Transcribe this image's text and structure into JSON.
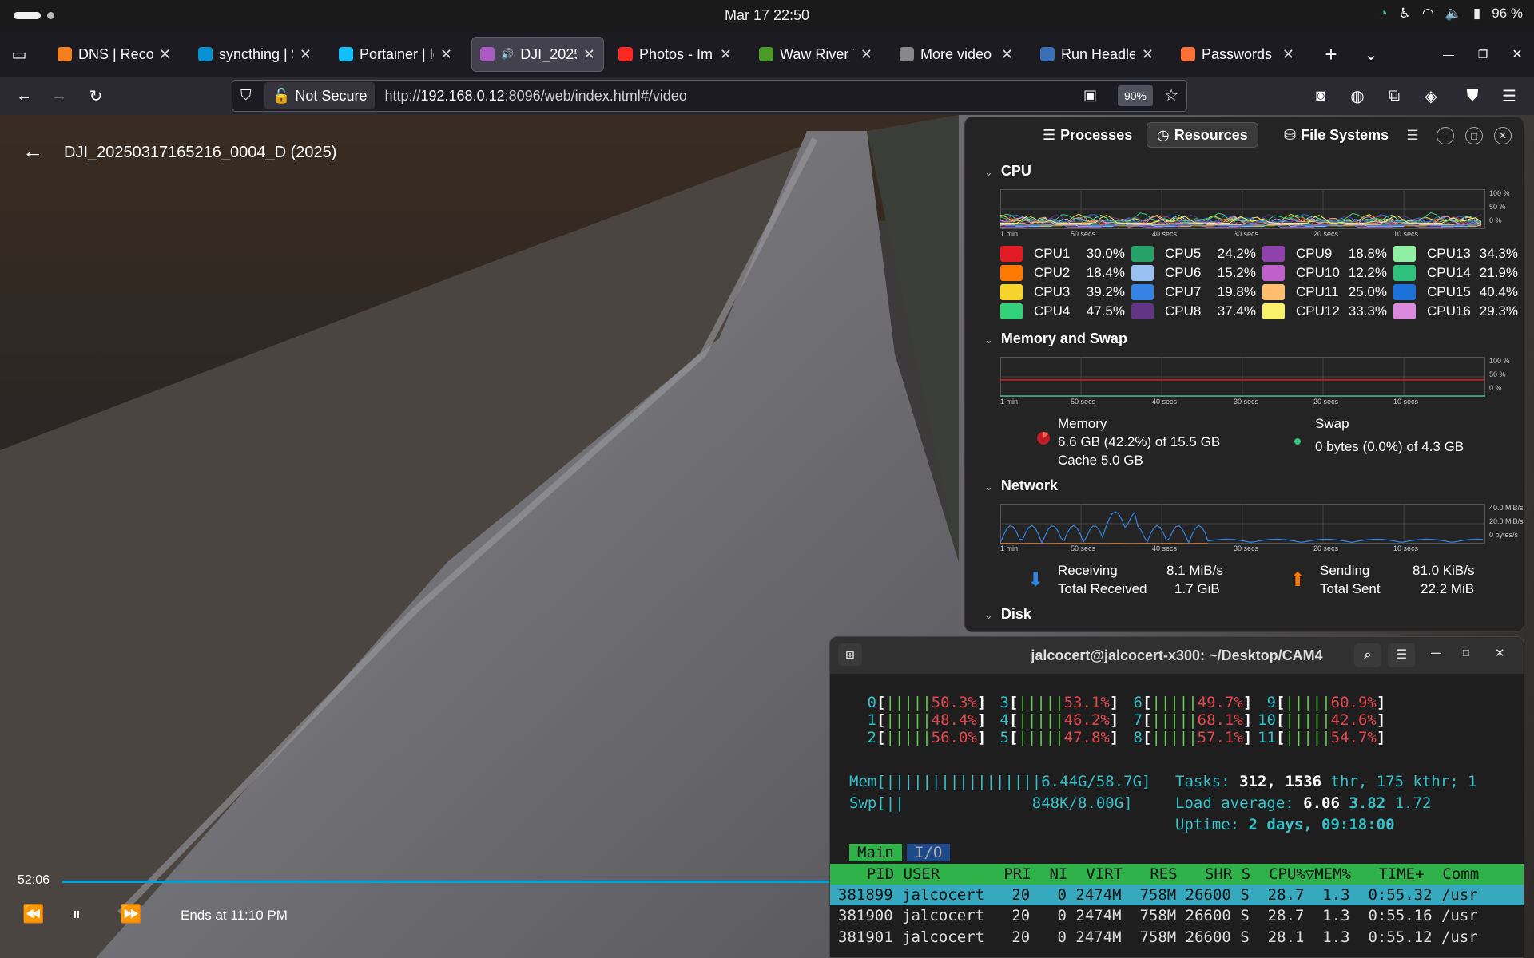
{
  "topbar": {
    "clock": "Mar 17  22:50",
    "battery": "96 %"
  },
  "tabs": [
    {
      "title": "DNS | Recor",
      "color": "#f38020"
    },
    {
      "title": "syncthing | S",
      "color": "#0891d1"
    },
    {
      "title": "Portainer | lo",
      "color": "#13bef9"
    },
    {
      "title": "DJI_2025",
      "color": "#aa5cc3"
    },
    {
      "title": "Photos - Imm",
      "color": "#fa2921"
    },
    {
      "title": "Waw River Tr",
      "color": "#4c9a2a"
    },
    {
      "title": "More video Trick",
      "color": "#888888"
    },
    {
      "title": "Run Headles",
      "color": "#3b6fb6"
    },
    {
      "title": "Passwords",
      "color": "#ff7139"
    }
  ],
  "nav": {
    "security": "Not Secure",
    "url_prefix": "http://",
    "url_host": "192.168.0.12",
    "url_rest": ":8096/web/index.html#/video",
    "zoom": "90%"
  },
  "video": {
    "title": "DJI_20250317165216_0004_D (2025)",
    "position": "52:06",
    "ends": "Ends at 11:10 PM",
    "accent": "#00a4dc"
  },
  "sysmon": {
    "tabs": {
      "processes": "Processes",
      "resources": "Resources",
      "filesystems": "File Systems"
    },
    "cpu_label": "CPU",
    "mem_label": "Memory and Swap",
    "net_label": "Network",
    "disk_label": "Disk",
    "graph_x_ticks": [
      "1 min",
      "50 secs",
      "40 secs",
      "30 secs",
      "20 secs",
      "10 secs"
    ],
    "cpu_y_ticks": [
      "100 %",
      "50 %",
      "0 %"
    ],
    "net_y_ticks": [
      "40.0 MiB/s",
      "20.0 MiB/s",
      "0 bytes/s"
    ],
    "cpus": [
      {
        "name": "CPU1",
        "pct": "30.0%",
        "color": "#e01b24"
      },
      {
        "name": "CPU5",
        "pct": "24.2%",
        "color": "#26a269"
      },
      {
        "name": "CPU9",
        "pct": "18.8%",
        "color": "#9141ac"
      },
      {
        "name": "CPU13",
        "pct": "34.3%",
        "color": "#8ff0a4"
      },
      {
        "name": "CPU2",
        "pct": "18.4%",
        "color": "#ff7800"
      },
      {
        "name": "CPU6",
        "pct": "15.2%",
        "color": "#99c1f1"
      },
      {
        "name": "CPU10",
        "pct": "12.2%",
        "color": "#c061cb"
      },
      {
        "name": "CPU14",
        "pct": "21.9%",
        "color": "#2ec27e"
      },
      {
        "name": "CPU3",
        "pct": "39.2%",
        "color": "#f6d32d"
      },
      {
        "name": "CPU7",
        "pct": "19.8%",
        "color": "#3584e4"
      },
      {
        "name": "CPU11",
        "pct": "25.0%",
        "color": "#ffbe6f"
      },
      {
        "name": "CPU15",
        "pct": "40.4%",
        "color": "#1c71d8"
      },
      {
        "name": "CPU4",
        "pct": "47.5%",
        "color": "#33d17a"
      },
      {
        "name": "CPU8",
        "pct": "37.4%",
        "color": "#613583"
      },
      {
        "name": "CPU12",
        "pct": "33.3%",
        "color": "#f9f06b"
      },
      {
        "name": "CPU16",
        "pct": "29.3%",
        "color": "#dc8add"
      }
    ],
    "memory": {
      "label": "Memory",
      "used": "6.6 GB (42.2%) of 15.5 GB",
      "cache": "Cache 5.0 GB",
      "fraction": 0.422
    },
    "swap": {
      "label": "Swap",
      "used": "0 bytes (0.0%) of 4.3 GB"
    },
    "network": {
      "recv_label": "Receiving",
      "recv": "8.1 MiB/s",
      "total_recv_label": "Total Received",
      "total_recv": "1.7 GiB",
      "send_label": "Sending",
      "send": "81.0 KiB/s",
      "total_sent_label": "Total Sent",
      "total_sent": "22.2 MiB"
    }
  },
  "terminal": {
    "title": "jalcocert@jalcocert-x300: ~/Desktop/CAM4",
    "cores": [
      {
        "id": "0",
        "bars": "|||||",
        "pct": "50.3%"
      },
      {
        "id": "3",
        "bars": "|||||",
        "pct": "53.1%"
      },
      {
        "id": "6",
        "bars": "|||||",
        "pct": "49.7%"
      },
      {
        "id": "9",
        "bars": "|||||",
        "pct": "60.9%"
      },
      {
        "id": "1",
        "bars": "|||||",
        "pct": "48.4%"
      },
      {
        "id": "4",
        "bars": "|||||",
        "pct": "46.2%"
      },
      {
        "id": "7",
        "bars": "|||||",
        "pct": "68.1%"
      },
      {
        "id": "10",
        "bars": "|||||",
        "pct": "42.6%"
      },
      {
        "id": "2",
        "bars": "|||||",
        "pct": "56.0%"
      },
      {
        "id": "5",
        "bars": "|||||",
        "pct": "47.8%"
      },
      {
        "id": "8",
        "bars": "|||||",
        "pct": "57.1%"
      },
      {
        "id": "11",
        "bars": "|||||",
        "pct": "54.7%"
      }
    ],
    "mem_line": "Mem[|||||||||||||||||6.44G/58.7G]",
    "swp_line": "Swp[||              848K/8.00G]",
    "tasks_label": "Tasks:",
    "tasks": "312,",
    "thr": "1536",
    "thr_rest": "thr, 175 kthr; 1",
    "load_label": "Load average:",
    "load1": "6.06",
    "load5": "3.82",
    "load15": "1.72",
    "uptime_label": "Uptime:",
    "uptime": "2 days, 09:18:00",
    "tab_main": "Main",
    "tab_io": "I/O",
    "columns": "    PID USER       PRI  NI  VIRT   RES   SHR S  CPU%▽MEM%   TIME+  Comm",
    "rows": [
      "381899 jalcocert   20   0 2474M  758M 26600 S  28.7  1.3  0:55.32 /usr",
      "381900 jalcocert   20   0 2474M  758M 26600 S  28.7  1.3  0:55.16 /usr",
      "381901 jalcocert   20   0 2474M  758M 26600 S  28.1  1.3  0:55.12 /usr"
    ]
  }
}
